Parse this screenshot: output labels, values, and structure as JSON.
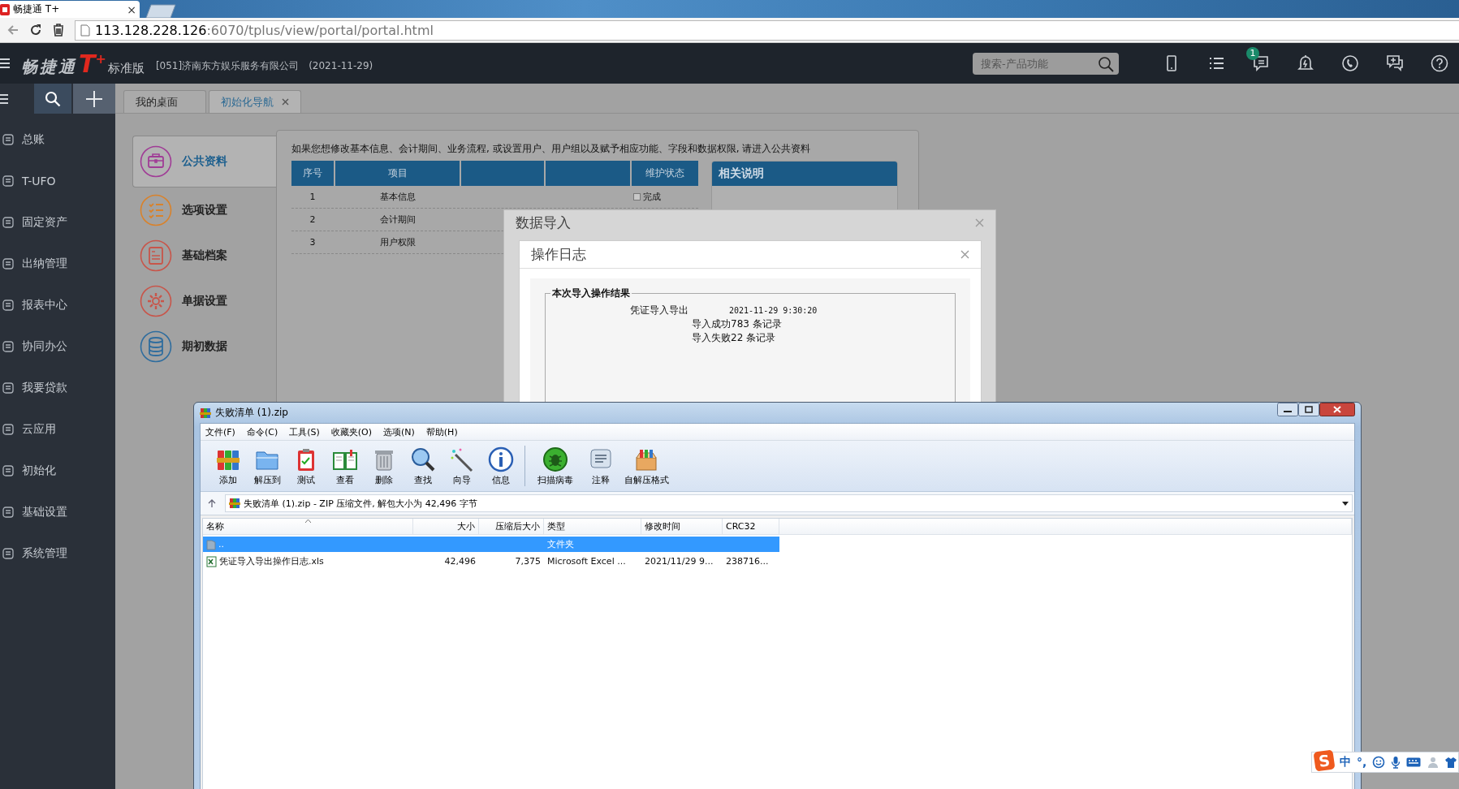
{
  "browser": {
    "tab": {
      "title": "畅捷通 T+",
      "close": "×"
    },
    "address": {
      "host": "113.128.228.126",
      "path": ":6070/tplus/view/portal/portal.html"
    }
  },
  "header": {
    "logo": {
      "name": "畅捷通",
      "mark": "T",
      "plus": "+",
      "edition": "标准版"
    },
    "company": "[051]济南东方娱乐服务有限公司",
    "date": "(2021-11-29)",
    "search": {
      "placeholder": "搜索-产品功能"
    },
    "message_badge": "1"
  },
  "sidebar": {
    "items": [
      {
        "label": "总账"
      },
      {
        "label": "T-UFO"
      },
      {
        "label": "固定资产"
      },
      {
        "label": "出纳管理"
      },
      {
        "label": "报表中心"
      },
      {
        "label": "协同办公"
      },
      {
        "label": "我要贷款"
      },
      {
        "label": "云应用"
      },
      {
        "label": "初始化"
      },
      {
        "label": "基础设置"
      },
      {
        "label": "系统管理"
      }
    ]
  },
  "tabs": [
    {
      "label": "我的桌面",
      "selected": false,
      "closable": false
    },
    {
      "label": "初始化导航",
      "selected": true,
      "closable": true
    }
  ],
  "portal": {
    "categories": [
      {
        "label": "公共资料",
        "selected": true,
        "color": "#a03c96"
      },
      {
        "label": "选项设置",
        "selected": false,
        "color": "#d9822b"
      },
      {
        "label": "基础档案",
        "selected": false,
        "color": "#c8554a"
      },
      {
        "label": "单据设置",
        "selected": false,
        "color": "#c8554a"
      },
      {
        "label": "期初数据",
        "selected": false,
        "color": "#2f6d9e"
      }
    ],
    "intro": "如果您想修改基本信息、会计期间、业务流程, 或设置用户、用户组以及赋予相应功能、字段和数据权限, 请进入公共资料",
    "table": {
      "columns": [
        "序号",
        "项目",
        "维护状态"
      ],
      "rows": [
        {
          "no": "1",
          "item": "基本信息",
          "status": "完成",
          "checked": false
        },
        {
          "no": "2",
          "item": "会计期间"
        },
        {
          "no": "3",
          "item": "用户权限"
        }
      ]
    },
    "related": {
      "title": "相关说明"
    }
  },
  "import_dialog": {
    "title": "数据导入",
    "log": {
      "title": "操作日志",
      "group_title": "本次导入操作结果",
      "entry": {
        "name": "凭证导入导出",
        "time": "2021-11-29 9:30:20"
      },
      "lines": [
        "导入成功783 条记录",
        "导入失败22 条记录"
      ]
    }
  },
  "zip_window": {
    "title": "失败清单 (1).zip",
    "menu": [
      "文件(F)",
      "命令(C)",
      "工具(S)",
      "收藏夹(O)",
      "选项(N)",
      "帮助(H)"
    ],
    "toolbar_groups": [
      [
        "添加",
        "解压到",
        "测试",
        "查看",
        "删除",
        "查找",
        "向导",
        "信息"
      ],
      [
        "扫描病毒",
        "注释",
        "自解压格式"
      ]
    ],
    "path": "失败清单 (1).zip - ZIP 压缩文件, 解包大小为 42,496 字节",
    "columns": [
      "名称",
      "大小",
      "压缩后大小",
      "类型",
      "修改时间",
      "CRC32"
    ],
    "rows": [
      {
        "kind": "parent",
        "name": "..",
        "type": "文件夹",
        "selected": true
      },
      {
        "kind": "file",
        "name": "凭证导入导出操作日志.xls",
        "size": "42,496",
        "packed": "7,375",
        "type": "Microsoft Excel ...",
        "modified": "2021/11/29 9...",
        "crc": "238716...",
        "selected": false
      }
    ]
  },
  "ime": {
    "logo": "S",
    "mode": "中",
    "punctuation": "°,"
  }
}
